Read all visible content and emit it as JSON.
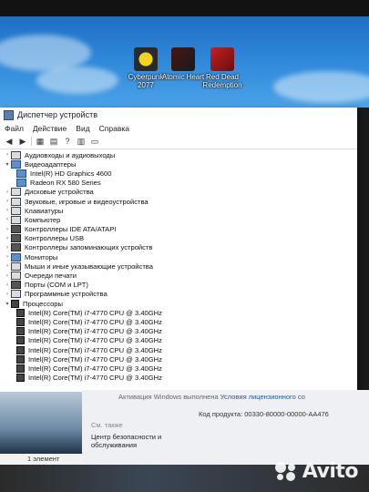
{
  "desktop": {
    "icons": [
      {
        "label": "Cyberpunk 2077",
        "color": "#d8c21a"
      },
      {
        "label": "Atomic Heart",
        "color": "#7a1010"
      },
      {
        "label": "Red Dead Redemption",
        "color": "#b31a1a"
      }
    ]
  },
  "window": {
    "title": "Диспетчер устройств",
    "menu": [
      "Файл",
      "Действие",
      "Вид",
      "Справка"
    ],
    "tree": [
      {
        "label": "Аудиовходы и аудиовыходы",
        "expanded": false,
        "level": 0,
        "icon": "speaker-icon"
      },
      {
        "label": "Видеоадаптеры",
        "expanded": true,
        "level": 0,
        "icon": "display-adapter-icon"
      },
      {
        "label": "Intel(R) HD Graphics 4600",
        "level": 1,
        "icon": "display-adapter-icon"
      },
      {
        "label": "Radeon RX 580 Series",
        "level": 1,
        "icon": "display-adapter-icon"
      },
      {
        "label": "Дисковые устройства",
        "expanded": false,
        "level": 0,
        "icon": "disk-icon"
      },
      {
        "label": "Звуковые, игровые и видеоустройства",
        "expanded": false,
        "level": 0,
        "icon": "sound-icon"
      },
      {
        "label": "Клавиатуры",
        "expanded": false,
        "level": 0,
        "icon": "keyboard-icon"
      },
      {
        "label": "Компьютер",
        "expanded": false,
        "level": 0,
        "icon": "computer-icon"
      },
      {
        "label": "Контроллеры IDE ATA/ATAPI",
        "expanded": false,
        "level": 0,
        "icon": "ide-icon"
      },
      {
        "label": "Контроллеры USB",
        "expanded": false,
        "level": 0,
        "icon": "usb-icon"
      },
      {
        "label": "Контроллеры запоминающих устройств",
        "expanded": false,
        "level": 0,
        "icon": "storage-icon"
      },
      {
        "label": "Мониторы",
        "expanded": false,
        "level": 0,
        "icon": "monitor-icon"
      },
      {
        "label": "Мыши и иные указывающие устройства",
        "expanded": false,
        "level": 0,
        "icon": "mouse-icon"
      },
      {
        "label": "Очереди печати",
        "expanded": false,
        "level": 0,
        "icon": "printer-icon"
      },
      {
        "label": "Порты (COM и LPT)",
        "expanded": false,
        "level": 0,
        "icon": "port-icon"
      },
      {
        "label": "Программные устройства",
        "expanded": false,
        "level": 0,
        "icon": "software-device-icon"
      },
      {
        "label": "Процессоры",
        "expanded": true,
        "level": 0,
        "icon": "cpu-icon"
      },
      {
        "label": "Intel(R) Core(TM) i7-4770 CPU @ 3.40GHz",
        "level": 1,
        "icon": "cpu-icon"
      },
      {
        "label": "Intel(R) Core(TM) i7-4770 CPU @ 3.40GHz",
        "level": 1,
        "icon": "cpu-icon"
      },
      {
        "label": "Intel(R) Core(TM) i7-4770 CPU @ 3.40GHz",
        "level": 1,
        "icon": "cpu-icon"
      },
      {
        "label": "Intel(R) Core(TM) i7-4770 CPU @ 3.40GHz",
        "level": 1,
        "icon": "cpu-icon"
      },
      {
        "label": "Intel(R) Core(TM) i7-4770 CPU @ 3.40GHz",
        "level": 1,
        "icon": "cpu-icon"
      },
      {
        "label": "Intel(R) Core(TM) i7-4770 CPU @ 3.40GHz",
        "level": 1,
        "icon": "cpu-icon"
      },
      {
        "label": "Intel(R) Core(TM) i7-4770 CPU @ 3.40GHz",
        "level": 1,
        "icon": "cpu-icon"
      },
      {
        "label": "Intel(R) Core(TM) i7-4770 CPU @ 3.40GHz",
        "level": 1,
        "icon": "cpu-icon"
      }
    ]
  },
  "background_panel": {
    "activation_text": "Активация Windows выполнена",
    "license_link": "Условия лицензионного со",
    "product_key": "Код продукта: 00330-80000-00000-AA476",
    "see_also": "См. также",
    "security": "Центр безопасности и обслуживания",
    "status": "1 элемент"
  },
  "watermark": "Avito"
}
